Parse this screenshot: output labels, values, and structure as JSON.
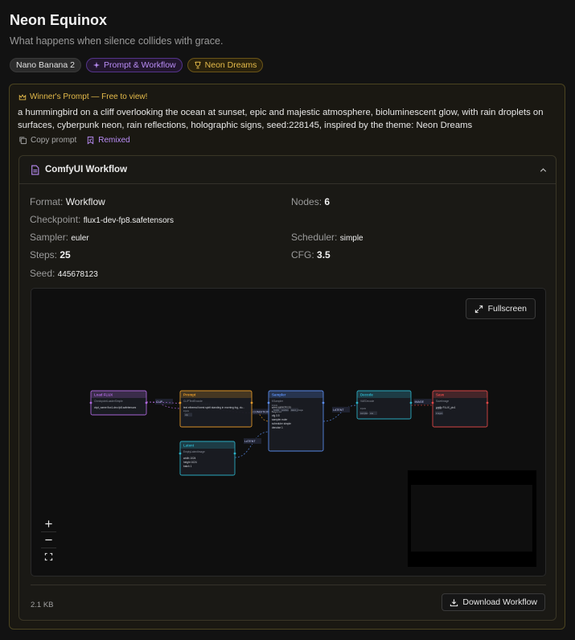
{
  "page": {
    "title": "Neon Equinox",
    "subtitle": "What happens when silence collides with grace."
  },
  "tags": {
    "model": "Nano Banana 2",
    "workflow": "Prompt & Workflow",
    "theme": "Neon Dreams"
  },
  "winner": {
    "label": "Winner's Prompt — Free to view!",
    "prompt": "a hummingbird on a cliff overlooking the ocean at sunset, epic and majestic atmosphere, bioluminescent glow, with rain droplets on surfaces, cyberpunk neon, rain reflections, holographic signs, seed:228145, inspired by the theme: Neon Dreams",
    "copy_label": "Copy prompt",
    "remixed_label": "Remixed"
  },
  "workflow": {
    "title": "ComfyUI Workflow",
    "format_label": "Format:",
    "format": "Workflow",
    "nodes_label": "Nodes:",
    "nodes": "6",
    "checkpoint_label": "Checkpoint:",
    "checkpoint": "flux1-dev-fp8.safetensors",
    "sampler_label": "Sampler:",
    "sampler": "euler",
    "scheduler_label": "Scheduler:",
    "scheduler": "simple",
    "steps_label": "Steps:",
    "steps": "25",
    "cfg_label": "CFG:",
    "cfg": "3.5",
    "seed_label": "Seed:",
    "seed": "445678123",
    "fullscreen_label": "Fullscreen",
    "file_size": "2.1 KB",
    "download_label": "Download Workflow"
  },
  "graph": {
    "nodes": [
      {
        "id": "load",
        "title": "Load FLUX",
        "type": "CheckpointLoaderSimple",
        "color": "#b06ae0",
        "fields": [
          "ckpt_name  flux1-dev-fp8.safetensors"
        ]
      },
      {
        "id": "prompt",
        "title": "Prompt",
        "type": "CLIPTextEncode",
        "color": "#e59a2a",
        "fields": [
          "text  ethereal forest spirit standing in morning fog, du..."
        ]
      },
      {
        "id": "latent",
        "title": "Latent",
        "type": "EmptyLatentImage",
        "color": "#2cb3c9",
        "fields": [
          "width  1024",
          "height  1024",
          "batch  1"
        ]
      },
      {
        "id": "sampler",
        "title": "Sampler",
        "type": "KSampler",
        "color": "#5b8ef0",
        "fields": [
          "seed  445678123",
          "steps  25",
          "cfg  3.5",
          "sampler  euler",
          "scheduler  simple",
          "denoise  1"
        ]
      },
      {
        "id": "decode",
        "title": "Decode",
        "type": "VAEDecode",
        "color": "#2cb3c9",
        "fields": []
      },
      {
        "id": "save",
        "title": "Save",
        "type": "SaveImage",
        "color": "#e04848",
        "fields": [
          "prefix  FLUX_pic1"
        ]
      }
    ],
    "edge_labels": [
      "CLIP",
      "MODEL",
      "CONDITIONING",
      "LATENT",
      "LATENT",
      "IMAGE"
    ],
    "slots": [
      "inputs",
      "clip",
      "model",
      "positive",
      "latent_image",
      "samples",
      "vae",
      "images"
    ]
  }
}
